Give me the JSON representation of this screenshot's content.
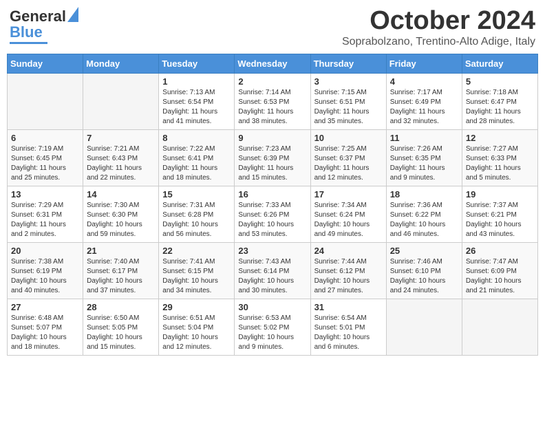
{
  "header": {
    "logo_line1": "General",
    "logo_line2": "Blue",
    "month": "October 2024",
    "location": "Soprabolzano, Trentino-Alto Adige, Italy"
  },
  "days_of_week": [
    "Sunday",
    "Monday",
    "Tuesday",
    "Wednesday",
    "Thursday",
    "Friday",
    "Saturday"
  ],
  "weeks": [
    [
      {
        "day": "",
        "info": ""
      },
      {
        "day": "",
        "info": ""
      },
      {
        "day": "1",
        "info": "Sunrise: 7:13 AM\nSunset: 6:54 PM\nDaylight: 11 hours and 41 minutes."
      },
      {
        "day": "2",
        "info": "Sunrise: 7:14 AM\nSunset: 6:53 PM\nDaylight: 11 hours and 38 minutes."
      },
      {
        "day": "3",
        "info": "Sunrise: 7:15 AM\nSunset: 6:51 PM\nDaylight: 11 hours and 35 minutes."
      },
      {
        "day": "4",
        "info": "Sunrise: 7:17 AM\nSunset: 6:49 PM\nDaylight: 11 hours and 32 minutes."
      },
      {
        "day": "5",
        "info": "Sunrise: 7:18 AM\nSunset: 6:47 PM\nDaylight: 11 hours and 28 minutes."
      }
    ],
    [
      {
        "day": "6",
        "info": "Sunrise: 7:19 AM\nSunset: 6:45 PM\nDaylight: 11 hours and 25 minutes."
      },
      {
        "day": "7",
        "info": "Sunrise: 7:21 AM\nSunset: 6:43 PM\nDaylight: 11 hours and 22 minutes."
      },
      {
        "day": "8",
        "info": "Sunrise: 7:22 AM\nSunset: 6:41 PM\nDaylight: 11 hours and 18 minutes."
      },
      {
        "day": "9",
        "info": "Sunrise: 7:23 AM\nSunset: 6:39 PM\nDaylight: 11 hours and 15 minutes."
      },
      {
        "day": "10",
        "info": "Sunrise: 7:25 AM\nSunset: 6:37 PM\nDaylight: 11 hours and 12 minutes."
      },
      {
        "day": "11",
        "info": "Sunrise: 7:26 AM\nSunset: 6:35 PM\nDaylight: 11 hours and 9 minutes."
      },
      {
        "day": "12",
        "info": "Sunrise: 7:27 AM\nSunset: 6:33 PM\nDaylight: 11 hours and 5 minutes."
      }
    ],
    [
      {
        "day": "13",
        "info": "Sunrise: 7:29 AM\nSunset: 6:31 PM\nDaylight: 11 hours and 2 minutes."
      },
      {
        "day": "14",
        "info": "Sunrise: 7:30 AM\nSunset: 6:30 PM\nDaylight: 10 hours and 59 minutes."
      },
      {
        "day": "15",
        "info": "Sunrise: 7:31 AM\nSunset: 6:28 PM\nDaylight: 10 hours and 56 minutes."
      },
      {
        "day": "16",
        "info": "Sunrise: 7:33 AM\nSunset: 6:26 PM\nDaylight: 10 hours and 53 minutes."
      },
      {
        "day": "17",
        "info": "Sunrise: 7:34 AM\nSunset: 6:24 PM\nDaylight: 10 hours and 49 minutes."
      },
      {
        "day": "18",
        "info": "Sunrise: 7:36 AM\nSunset: 6:22 PM\nDaylight: 10 hours and 46 minutes."
      },
      {
        "day": "19",
        "info": "Sunrise: 7:37 AM\nSunset: 6:21 PM\nDaylight: 10 hours and 43 minutes."
      }
    ],
    [
      {
        "day": "20",
        "info": "Sunrise: 7:38 AM\nSunset: 6:19 PM\nDaylight: 10 hours and 40 minutes."
      },
      {
        "day": "21",
        "info": "Sunrise: 7:40 AM\nSunset: 6:17 PM\nDaylight: 10 hours and 37 minutes."
      },
      {
        "day": "22",
        "info": "Sunrise: 7:41 AM\nSunset: 6:15 PM\nDaylight: 10 hours and 34 minutes."
      },
      {
        "day": "23",
        "info": "Sunrise: 7:43 AM\nSunset: 6:14 PM\nDaylight: 10 hours and 30 minutes."
      },
      {
        "day": "24",
        "info": "Sunrise: 7:44 AM\nSunset: 6:12 PM\nDaylight: 10 hours and 27 minutes."
      },
      {
        "day": "25",
        "info": "Sunrise: 7:46 AM\nSunset: 6:10 PM\nDaylight: 10 hours and 24 minutes."
      },
      {
        "day": "26",
        "info": "Sunrise: 7:47 AM\nSunset: 6:09 PM\nDaylight: 10 hours and 21 minutes."
      }
    ],
    [
      {
        "day": "27",
        "info": "Sunrise: 6:48 AM\nSunset: 5:07 PM\nDaylight: 10 hours and 18 minutes."
      },
      {
        "day": "28",
        "info": "Sunrise: 6:50 AM\nSunset: 5:05 PM\nDaylight: 10 hours and 15 minutes."
      },
      {
        "day": "29",
        "info": "Sunrise: 6:51 AM\nSunset: 5:04 PM\nDaylight: 10 hours and 12 minutes."
      },
      {
        "day": "30",
        "info": "Sunrise: 6:53 AM\nSunset: 5:02 PM\nDaylight: 10 hours and 9 minutes."
      },
      {
        "day": "31",
        "info": "Sunrise: 6:54 AM\nSunset: 5:01 PM\nDaylight: 10 hours and 6 minutes."
      },
      {
        "day": "",
        "info": ""
      },
      {
        "day": "",
        "info": ""
      }
    ]
  ]
}
